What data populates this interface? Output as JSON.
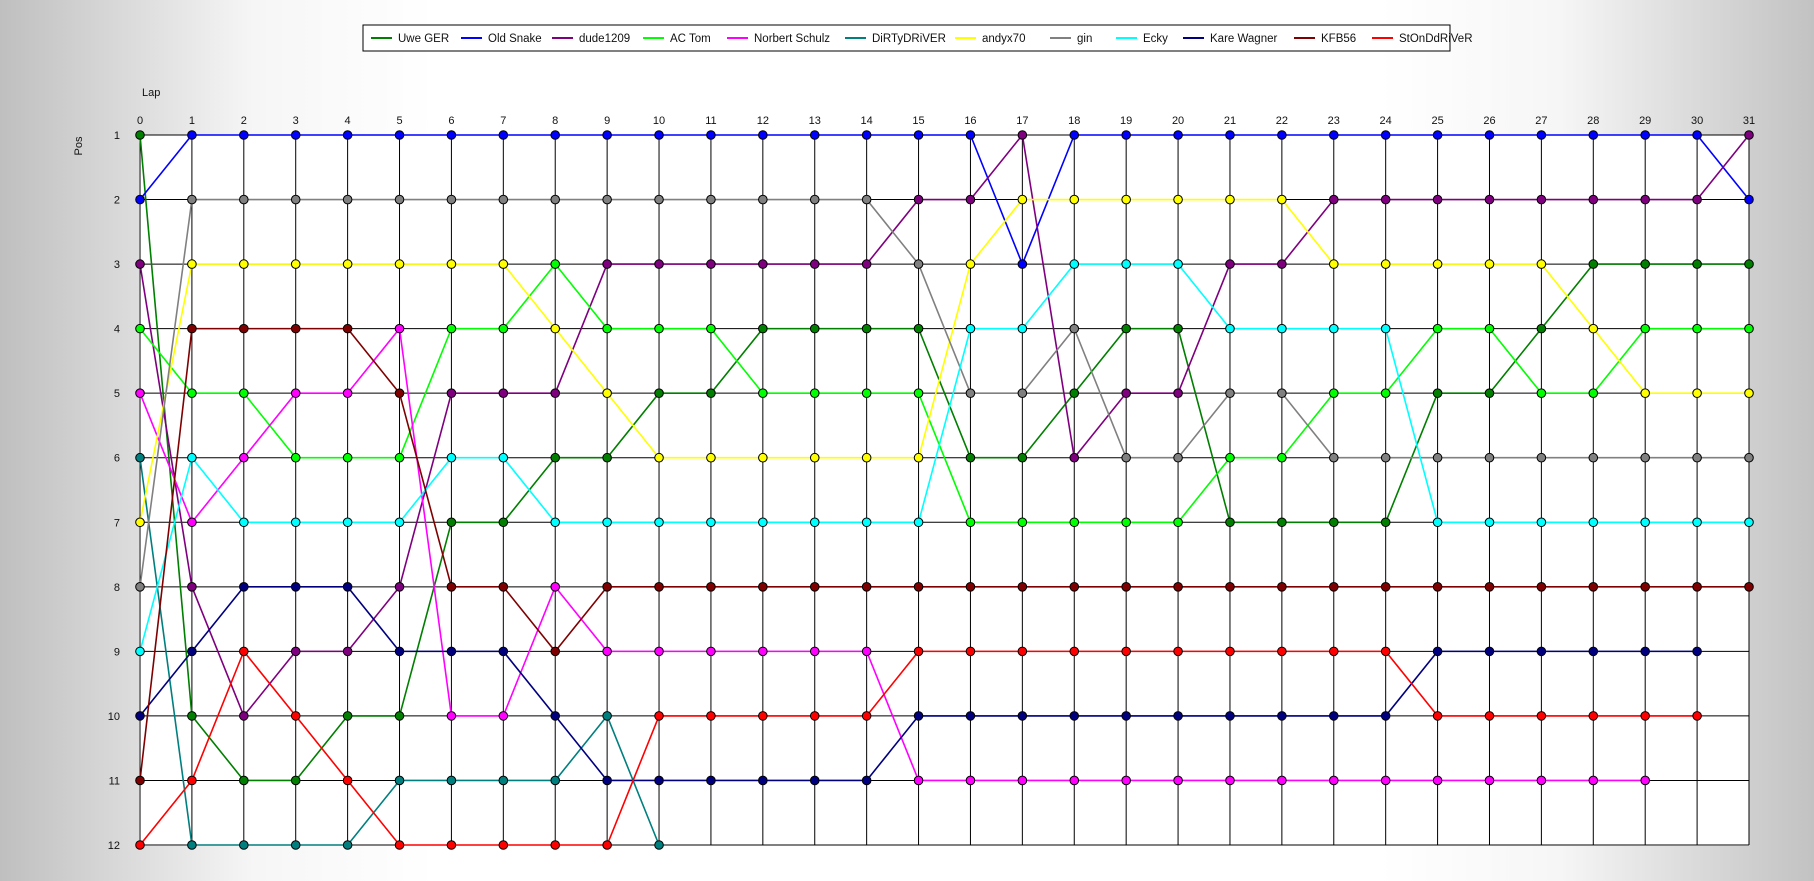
{
  "chart_data": {
    "type": "line",
    "title": "",
    "xlabel": "Lap",
    "ylabel": "Pos",
    "x_axis_position": "top",
    "y_axis_inverted": true,
    "xlim": [
      0,
      31
    ],
    "ylim": [
      1,
      12
    ],
    "grid": true,
    "legend_position": "top",
    "x": [
      0,
      1,
      2,
      3,
      4,
      5,
      6,
      7,
      8,
      9,
      10,
      11,
      12,
      13,
      14,
      15,
      16,
      17,
      18,
      19,
      20,
      21,
      22,
      23,
      24,
      25,
      26,
      27,
      28,
      29,
      30,
      31
    ],
    "y_ticks": [
      1,
      2,
      3,
      4,
      5,
      6,
      7,
      8,
      9,
      10,
      11,
      12
    ],
    "series": [
      {
        "name": "Uwe GER",
        "color": "#007f00",
        "values": [
          1,
          10,
          11,
          11,
          10,
          10,
          7,
          7,
          6,
          6,
          5,
          5,
          4,
          4,
          4,
          4,
          6,
          6,
          5,
          4,
          4,
          7,
          7,
          7,
          7,
          5,
          5,
          4,
          3,
          3,
          3,
          3
        ]
      },
      {
        "name": "Old Snake",
        "color": "#0000ff",
        "values": [
          2,
          1,
          1,
          1,
          1,
          1,
          1,
          1,
          1,
          1,
          1,
          1,
          1,
          1,
          1,
          1,
          1,
          3,
          1,
          1,
          1,
          1,
          1,
          1,
          1,
          1,
          1,
          1,
          1,
          1,
          1,
          2
        ]
      },
      {
        "name": "dude1209",
        "color": "#7f007f",
        "values": [
          3,
          8,
          10,
          9,
          9,
          8,
          5,
          5,
          5,
          3,
          3,
          3,
          3,
          3,
          3,
          2,
          2,
          1,
          6,
          5,
          5,
          3,
          3,
          2,
          2,
          2,
          2,
          2,
          2,
          2,
          2,
          1
        ]
      },
      {
        "name": "AC Tom",
        "color": "#00ff00",
        "values": [
          4,
          5,
          5,
          6,
          6,
          6,
          4,
          4,
          3,
          4,
          4,
          4,
          5,
          5,
          5,
          5,
          7,
          7,
          7,
          7,
          7,
          6,
          6,
          5,
          5,
          4,
          4,
          5,
          5,
          4,
          4,
          4
        ]
      },
      {
        "name": "Norbert Schulz",
        "color": "#ff00ff",
        "values": [
          5,
          7,
          6,
          5,
          5,
          4,
          10,
          10,
          8,
          9,
          9,
          9,
          9,
          9,
          9,
          11,
          11,
          11,
          11,
          11,
          11,
          11,
          11,
          11,
          11,
          11,
          11,
          11,
          11,
          11,
          null,
          null
        ]
      },
      {
        "name": "DiRTyDRiVER",
        "color": "#007f7f",
        "values": [
          6,
          12,
          12,
          12,
          12,
          11,
          11,
          11,
          11,
          10,
          12,
          null,
          null,
          null,
          null,
          null,
          null,
          null,
          null,
          null,
          null,
          null,
          null,
          null,
          null,
          null,
          null,
          null,
          null,
          null,
          null,
          null
        ]
      },
      {
        "name": "andyx70",
        "color": "#ffff00",
        "values": [
          7,
          3,
          3,
          3,
          3,
          3,
          3,
          3,
          4,
          5,
          6,
          6,
          6,
          6,
          6,
          6,
          3,
          2,
          2,
          2,
          2,
          2,
          2,
          3,
          3,
          3,
          3,
          3,
          4,
          5,
          5,
          5
        ]
      },
      {
        "name": "gin",
        "color": "#808080",
        "values": [
          8,
          2,
          2,
          2,
          2,
          2,
          2,
          2,
          2,
          2,
          2,
          2,
          2,
          2,
          2,
          3,
          5,
          5,
          4,
          6,
          6,
          5,
          5,
          6,
          6,
          6,
          6,
          6,
          6,
          6,
          6,
          6
        ]
      },
      {
        "name": "Ecky",
        "color": "#00ffff",
        "values": [
          9,
          6,
          7,
          7,
          7,
          7,
          6,
          6,
          7,
          7,
          7,
          7,
          7,
          7,
          7,
          7,
          4,
          4,
          3,
          3,
          3,
          4,
          4,
          4,
          4,
          7,
          7,
          7,
          7,
          7,
          7,
          7
        ]
      },
      {
        "name": "Kare Wagner",
        "color": "#00007f",
        "values": [
          10,
          9,
          8,
          8,
          8,
          9,
          9,
          9,
          10,
          11,
          11,
          11,
          11,
          11,
          11,
          10,
          10,
          10,
          10,
          10,
          10,
          10,
          10,
          10,
          10,
          9,
          9,
          9,
          9,
          9,
          9,
          null
        ]
      },
      {
        "name": "KFB56",
        "color": "#7f0000",
        "values": [
          11,
          4,
          4,
          4,
          4,
          5,
          8,
          8,
          9,
          8,
          8,
          8,
          8,
          8,
          8,
          8,
          8,
          8,
          8,
          8,
          8,
          8,
          8,
          8,
          8,
          8,
          8,
          8,
          8,
          8,
          8,
          8
        ]
      },
      {
        "name": "StOnDdRiVeR",
        "color": "#ff0000",
        "values": [
          12,
          11,
          9,
          10,
          11,
          12,
          12,
          12,
          12,
          12,
          10,
          10,
          10,
          10,
          10,
          9,
          9,
          9,
          9,
          9,
          9,
          9,
          9,
          9,
          9,
          10,
          10,
          10,
          10,
          10,
          10,
          null
        ]
      }
    ]
  }
}
